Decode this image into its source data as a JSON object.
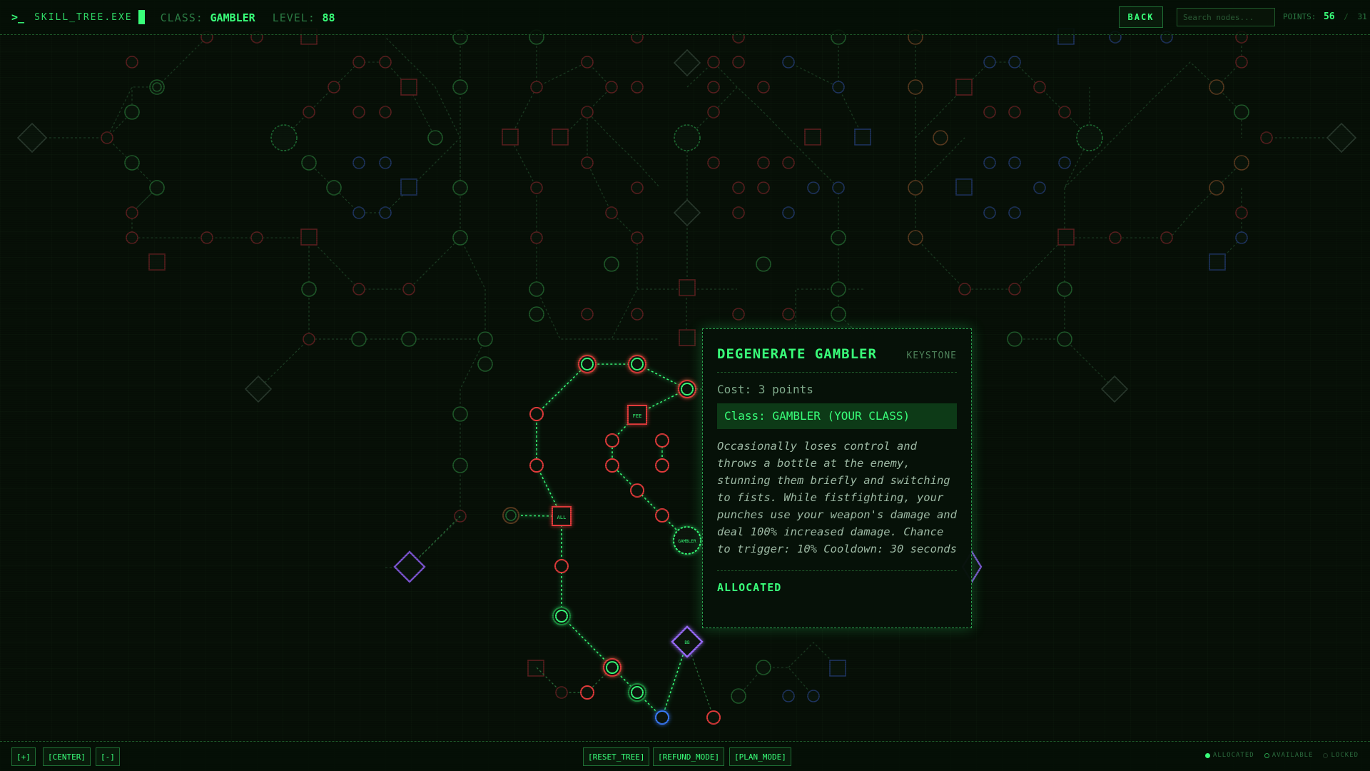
{
  "header": {
    "prompt": ">_",
    "app_name": "SKILL_TREE.EXE",
    "class_label": "CLASS:",
    "class_value": "GAMBLER",
    "level_label": "LEVEL:",
    "level_value": "88",
    "back_label": "BACK",
    "search_placeholder": "Search nodes...",
    "points_label": "POINTS:",
    "points_current": "56",
    "points_separator": "/",
    "points_max": "31"
  },
  "colors": {
    "allocated": "#39ff7a",
    "available_red": "#e23b3b",
    "blue": "#3a7dff",
    "purple": "#9b6cff",
    "background": "#071007"
  },
  "tree_labels": {
    "all": "ALL",
    "fee": "FEE",
    "gambler": "GAMBLER",
    "keystone_small": "BB"
  },
  "tooltip": {
    "title": "DEGENERATE GAMBLER",
    "type": "KEYSTONE",
    "cost": "Cost: 3 points",
    "class_line": "Class: GAMBLER (YOUR CLASS)",
    "description": "Occasionally loses control and throws a bottle at the enemy, stunning them briefly and switching to fists. While fistfighting, your punches use your weapon's damage and deal 100% increased damage. Chance to trigger: 10% Cooldown: 30 seconds",
    "status": "ALLOCATED"
  },
  "bottom": {
    "zoom_in": "[+]",
    "center": "[CENTER]",
    "zoom_out": "[-]",
    "reset": "[RESET_TREE]",
    "refund": "[REFUND_MODE]",
    "plan": "[PLAN_MODE]",
    "legend_allocated": "ALLOCATED",
    "legend_available": "AVAILABLE",
    "legend_locked": "LOCKED"
  }
}
